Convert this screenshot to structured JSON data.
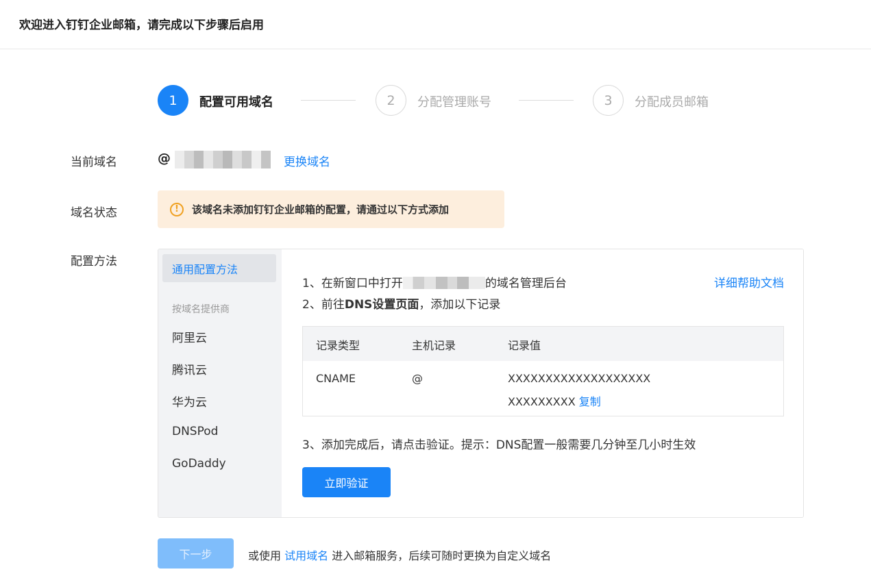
{
  "header": {
    "title": "欢迎进入钉钉企业邮箱，请完成以下步骤后启用"
  },
  "steps": [
    {
      "number": "1",
      "label": "配置可用域名",
      "state": "active"
    },
    {
      "number": "2",
      "label": "分配管理账号",
      "state": "inactive"
    },
    {
      "number": "3",
      "label": "分配成员邮箱",
      "state": "inactive"
    }
  ],
  "domain_row": {
    "label": "当前域名",
    "at_sign": "@",
    "change_link": "更换域名"
  },
  "status_row": {
    "label": "域名状态",
    "warning_icon": "!",
    "warning_text": "该域名未添加钉钉企业邮箱的配置，请通过以下方式添加"
  },
  "method_row": {
    "label": "配置方法"
  },
  "config": {
    "general_tab": "通用配置方法",
    "provider_heading": "按域名提供商",
    "providers": [
      "阿里云",
      "腾讯云",
      "华为云",
      "DNSPod",
      "GoDaddy"
    ],
    "step1_prefix": "1、在新窗口中打开",
    "step1_suffix": "的域名管理后台",
    "help_link": "详细帮助文档",
    "step2_prefix": "2、前往",
    "step2_bold": "DNS设置页面",
    "step2_suffix": "，添加以下记录",
    "table": {
      "headers": [
        "记录类型",
        "主机记录",
        "记录值"
      ],
      "row": {
        "type": "CNAME",
        "host": "@",
        "value_line1": "XXXXXXXXXXXXXXXXXXX",
        "value_line2": "XXXXXXXXX",
        "copy_label": "复制"
      }
    },
    "step3": "3、添加完成后，请点击验证。提示：DNS配置一般需要几分钟至几小时生效",
    "verify_button": "立即验证"
  },
  "footer": {
    "next_button": "下一步",
    "text_prefix": "或使用",
    "trial_link": "试用域名",
    "text_suffix": "进入邮箱服务，后续可随时更换为自定义域名"
  },
  "colors": {
    "accent": "#1a84f7",
    "warning_bg": "#fdeedd",
    "warning_icon": "#f0a020",
    "disabled_button": "#7fbdfb"
  }
}
